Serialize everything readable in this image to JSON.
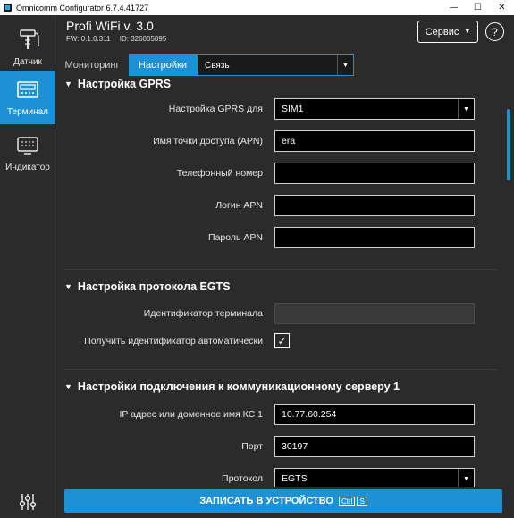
{
  "window": {
    "title": "Omnicomm Configurator 6.7.4.41727",
    "controls": {
      "minimize": "—",
      "maximize": "☐",
      "close": "✕"
    }
  },
  "sidebar": {
    "items": [
      {
        "label": "Датчик",
        "icon": "sensor-icon",
        "active": false
      },
      {
        "label": "Терминал",
        "icon": "terminal-icon",
        "active": true
      },
      {
        "label": "Индикатор",
        "icon": "indicator-icon",
        "active": false
      }
    ],
    "bottom_icon": "sliders-icon"
  },
  "header": {
    "device_title": "Profi WiFi v. 3.0",
    "fw": "FW: 0.1.0.311",
    "id": "ID: 326005895",
    "service_label": "Сервис",
    "help_label": "?"
  },
  "tabs": {
    "monitoring": "Мониторинг",
    "settings": "Настройки",
    "dropdown_value": "Связь"
  },
  "sections": {
    "gprs": {
      "title": "Настройка GPRS",
      "rows": [
        {
          "label": "Настройка GPRS для",
          "value": "SIM1"
        },
        {
          "label": "Имя точки доступа (APN)",
          "value": "era"
        },
        {
          "label": "Телефонный номер",
          "value": ""
        },
        {
          "label": "Логин APN",
          "value": ""
        },
        {
          "label": "Пароль APN",
          "value": ""
        }
      ]
    },
    "egts": {
      "title": "Настройка протокола EGTS",
      "terminal_id_label": "Идентификатор терминала",
      "terminal_id_value": "",
      "auto_id_label": "Получить идентификатор автоматически",
      "auto_id_checked": "✓"
    },
    "server": {
      "title": "Настройки подключения к коммуникационному серверу 1",
      "rows": [
        {
          "label": "IP адрес или доменное имя КС 1",
          "value": "10.77.60.254"
        },
        {
          "label": "Порт",
          "value": "30197"
        },
        {
          "label": "Протокол",
          "value": "EGTS"
        }
      ]
    }
  },
  "footer": {
    "write_label": "ЗАПИСАТЬ В УСТРОЙСТВО",
    "shortcut_ctrl": "Ctrl",
    "shortcut_key": "S"
  },
  "colors": {
    "accent": "#1e90d6",
    "background": "#2b2b2b"
  }
}
